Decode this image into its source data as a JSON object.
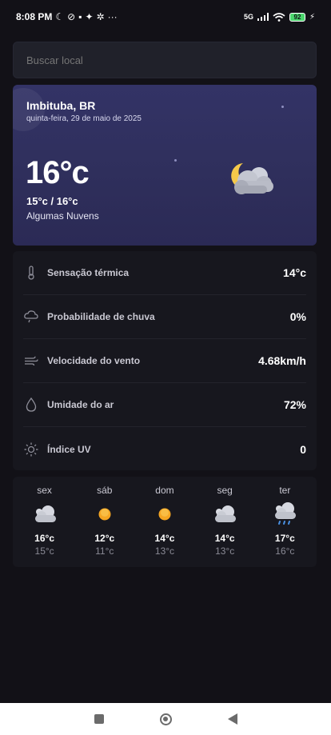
{
  "status_bar": {
    "time": "8:08 PM",
    "network": "5G",
    "battery": "92"
  },
  "search": {
    "placeholder": "Buscar local"
  },
  "current": {
    "city": "Imbituba, BR",
    "date": "quinta-feira, 29 de maio de 2025",
    "temperature": "16°c",
    "min_max": "15°c / 16°c",
    "description": "Algumas Nuvens",
    "icon": "cloudy-night-icon"
  },
  "details": [
    {
      "icon": "thermometer-icon",
      "label": "Sensação térmica",
      "value": "14°c"
    },
    {
      "icon": "rain-cloud-icon",
      "label": "Probabilidade de chuva",
      "value": "0%"
    },
    {
      "icon": "wind-icon",
      "label": "Velocidade do vento",
      "value": "4.68km/h"
    },
    {
      "icon": "droplet-icon",
      "label": "Umidade do ar",
      "value": "72%"
    },
    {
      "icon": "sun-icon",
      "label": "Índice UV",
      "value": "0"
    }
  ],
  "forecast": [
    {
      "day": "sex",
      "icon": "partly-cloudy-icon",
      "max": "16°c",
      "min": "15°c"
    },
    {
      "day": "sáb",
      "icon": "sunny-icon",
      "max": "12°c",
      "min": "11°c"
    },
    {
      "day": "dom",
      "icon": "sunny-icon",
      "max": "14°c",
      "min": "13°c"
    },
    {
      "day": "seg",
      "icon": "partly-cloudy-icon",
      "max": "14°c",
      "min": "13°c"
    },
    {
      "day": "ter",
      "icon": "rain-icon",
      "max": "17°c",
      "min": "16°c"
    }
  ],
  "colors": {
    "background": "#121117",
    "hero_gradient_top": "#333366",
    "card": "#17171e",
    "sun": "#f5a623"
  }
}
